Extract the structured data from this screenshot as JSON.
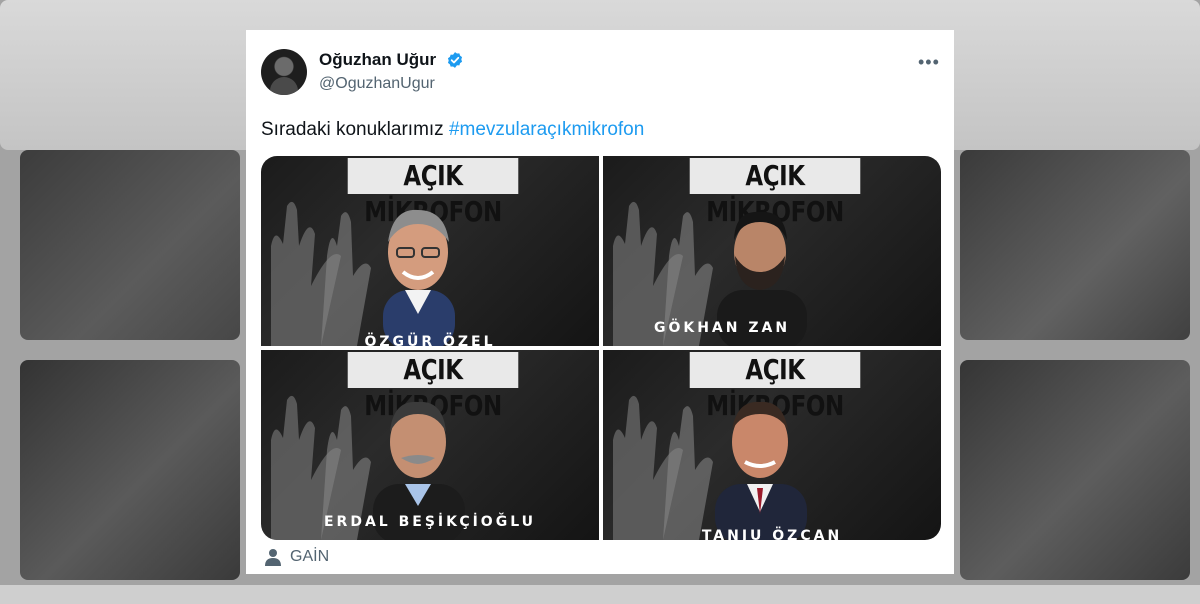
{
  "tweet": {
    "author_name": "Oğuzhan Uğur",
    "author_handle": "@OguzhanUgur",
    "text": "Sıradaki konuklarımız ",
    "hashtag": "#mevzularaçıkmikrofon",
    "more_icon": "more-horizontal-icon",
    "verified_icon": "verified-badge-icon",
    "accent_color": "#1d9bf0"
  },
  "media": {
    "tiles": [
      {
        "banner": "AÇIK MİKROFON",
        "caption": "ÖZGÜR ÖZEL"
      },
      {
        "banner": "AÇIK MİKROFON",
        "caption": "GÖKHAN ZAN"
      },
      {
        "banner": "AÇIK MİKROFON",
        "caption": "ERDAL BEŞİKÇİOĞLU"
      },
      {
        "banner": "AÇIK MİKROFON",
        "caption": "TANJU ÖZCAN"
      }
    ]
  },
  "footer": {
    "icon": "user-icon",
    "label": "GAİN"
  }
}
